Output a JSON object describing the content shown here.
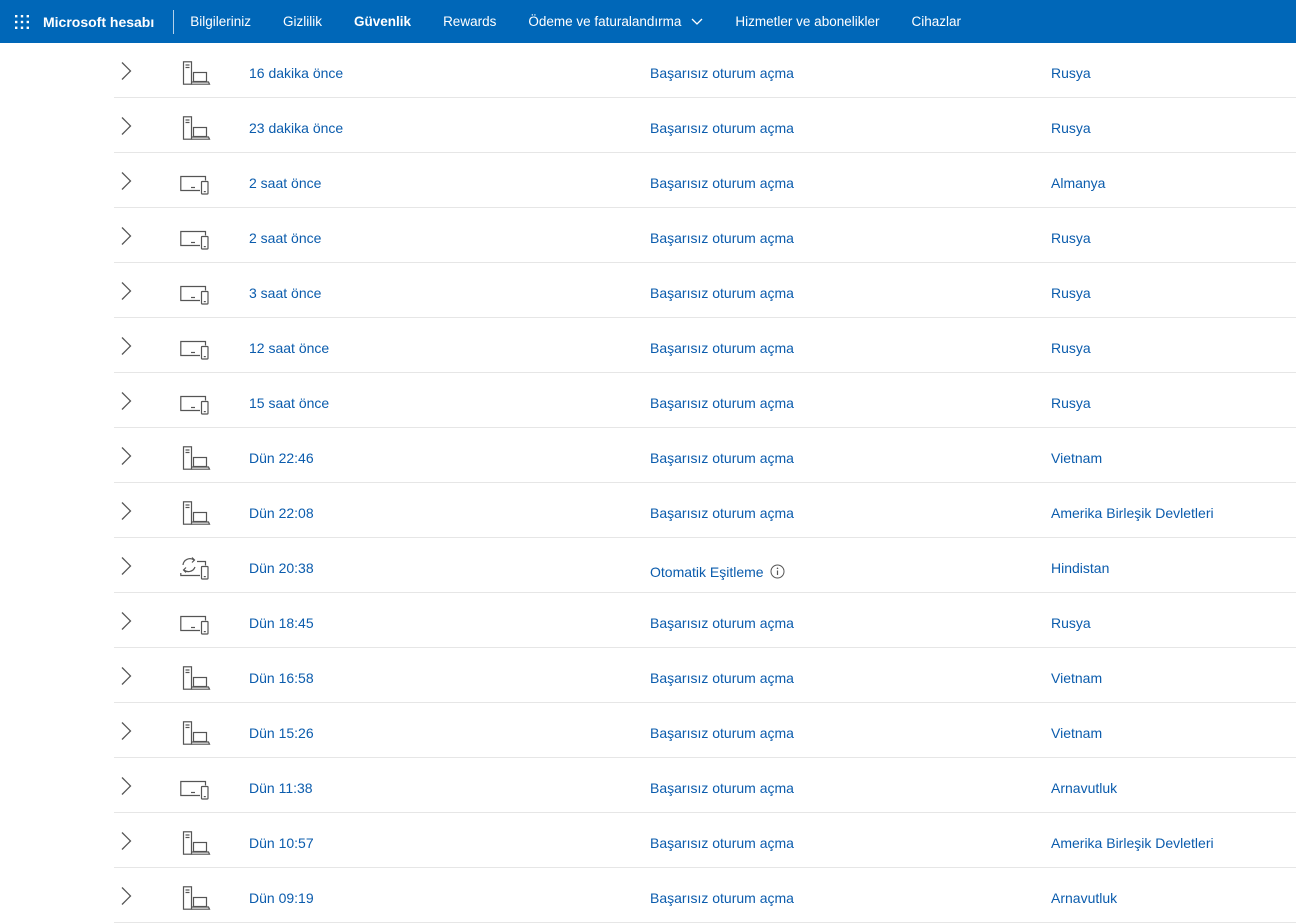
{
  "nav": {
    "brand": "Microsoft hesabı",
    "items": [
      {
        "label": "Bilgileriniz",
        "active": false
      },
      {
        "label": "Gizlilik",
        "active": false
      },
      {
        "label": "Güvenlik",
        "active": true
      },
      {
        "label": "Rewards",
        "active": false
      },
      {
        "label": "Ödeme ve faturalandırma",
        "active": false,
        "dropdown": true
      },
      {
        "label": "Hizmetler ve abonelikler",
        "active": false
      },
      {
        "label": "Cihazlar",
        "active": false
      }
    ]
  },
  "colors": {
    "nav_bg": "#0067b8",
    "link": "#0b5cad",
    "divider": "#e6e6e6",
    "icon": "#555555"
  },
  "activity": [
    {
      "time": "16 dakika önce",
      "type": "Başarısız oturum açma",
      "location": "Rusya",
      "device_icon": "desktop-tower-icon"
    },
    {
      "time": "23 dakika önce",
      "type": "Başarısız oturum açma",
      "location": "Rusya",
      "device_icon": "desktop-tower-icon"
    },
    {
      "time": "2 saat önce",
      "type": "Başarısız oturum açma",
      "location": "Almanya",
      "device_icon": "laptop-phone-icon"
    },
    {
      "time": "2 saat önce",
      "type": "Başarısız oturum açma",
      "location": "Rusya",
      "device_icon": "laptop-phone-icon"
    },
    {
      "time": "3 saat önce",
      "type": "Başarısız oturum açma",
      "location": "Rusya",
      "device_icon": "laptop-phone-icon"
    },
    {
      "time": "12 saat önce",
      "type": "Başarısız oturum açma",
      "location": "Rusya",
      "device_icon": "laptop-phone-icon"
    },
    {
      "time": "15 saat önce",
      "type": "Başarısız oturum açma",
      "location": "Rusya",
      "device_icon": "laptop-phone-icon"
    },
    {
      "time": "Dün 22:46",
      "type": "Başarısız oturum açma",
      "location": "Vietnam",
      "device_icon": "desktop-tower-icon"
    },
    {
      "time": "Dün 22:08",
      "type": "Başarısız oturum açma",
      "location": "Amerika Birleşik Devletleri",
      "device_icon": "desktop-tower-icon"
    },
    {
      "time": "Dün 20:38",
      "type": "Otomatik Eşitleme",
      "location": "Hindistan",
      "device_icon": "sync-devices-icon",
      "info": true
    },
    {
      "time": "Dün 18:45",
      "type": "Başarısız oturum açma",
      "location": "Rusya",
      "device_icon": "laptop-phone-icon"
    },
    {
      "time": "Dün 16:58",
      "type": "Başarısız oturum açma",
      "location": "Vietnam",
      "device_icon": "desktop-tower-icon"
    },
    {
      "time": "Dün 15:26",
      "type": "Başarısız oturum açma",
      "location": "Vietnam",
      "device_icon": "desktop-tower-icon"
    },
    {
      "time": "Dün 11:38",
      "type": "Başarısız oturum açma",
      "location": "Arnavutluk",
      "device_icon": "laptop-phone-icon"
    },
    {
      "time": "Dün 10:57",
      "type": "Başarısız oturum açma",
      "location": "Amerika Birleşik Devletleri",
      "device_icon": "desktop-tower-icon"
    },
    {
      "time": "Dün 09:19",
      "type": "Başarısız oturum açma",
      "location": "Arnavutluk",
      "device_icon": "desktop-tower-icon"
    }
  ]
}
